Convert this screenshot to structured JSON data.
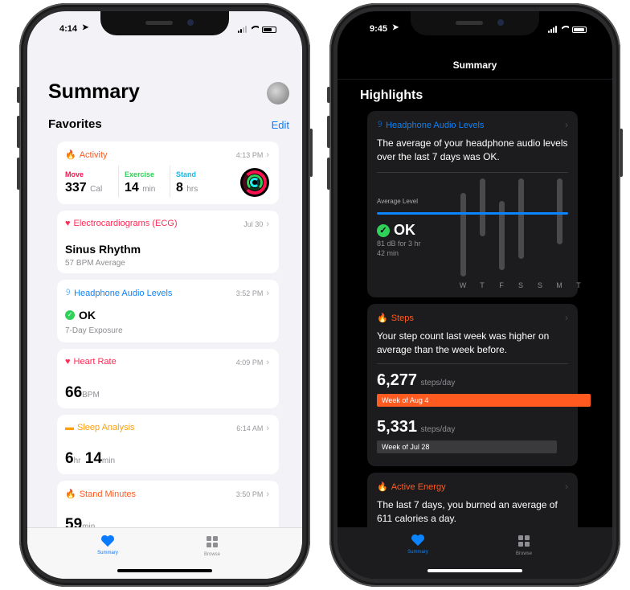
{
  "left": {
    "status_time": "4:14",
    "title": "Summary",
    "favorites": "Favorites",
    "edit": "Edit",
    "activity": {
      "label": "Activity",
      "time": "4:13 PM",
      "move_label": "Move",
      "move_value": "337",
      "move_unit": "Cal",
      "exercise_label": "Exercise",
      "exercise_value": "14",
      "exercise_unit": "min",
      "stand_label": "Stand",
      "stand_value": "8",
      "stand_unit": "hrs"
    },
    "ecg": {
      "label": "Electrocardiograms (ECG)",
      "time": "Jul 30",
      "value": "Sinus Rhythm",
      "sub": "57 BPM Average"
    },
    "audio": {
      "label": "Headphone Audio Levels",
      "time": "3:52 PM",
      "value": "OK",
      "sub": "7-Day Exposure"
    },
    "heart": {
      "label": "Heart Rate",
      "time": "4:09 PM",
      "value": "66",
      "unit": "BPM"
    },
    "sleep": {
      "label": "Sleep Analysis",
      "time": "6:14 AM",
      "h": "6",
      "h_unit": "hr",
      "m": "14",
      "m_unit": "min"
    },
    "stand": {
      "label": "Stand Minutes",
      "time": "3:50 PM",
      "value": "59",
      "unit": "min"
    },
    "tabs": {
      "summary": "Summary",
      "browse": "Browse"
    }
  },
  "right": {
    "status_time": "9:45",
    "header": "Summary",
    "highlights": "Highlights",
    "audio": {
      "label": "Headphone Audio Levels",
      "text": "The average of your headphone audio levels over the last 7 days was OK.",
      "avg_label": "Average Level",
      "value": "OK",
      "sub1": "81 dB for 3 hr",
      "sub2": "42 min",
      "days": [
        "W",
        "T",
        "F",
        "S",
        "S",
        "M",
        "T"
      ]
    },
    "steps": {
      "label": "Steps",
      "text": "Your step count last week was higher on average than the week before.",
      "v1": "6,277",
      "v1_unit": "steps/day",
      "v1_week": "Week of Aug 4",
      "v2": "5,331",
      "v2_unit": "steps/day",
      "v2_week": "Week of Jul 28"
    },
    "energy": {
      "label": "Active Energy",
      "text": "The last 7 days, you burned an average of 611 calories a day."
    },
    "tabs": {
      "summary": "Summary",
      "browse": "Browse"
    }
  },
  "colors": {
    "activity": "#ff5a1f",
    "ecg": "#ff2d55",
    "audio": "#0a84ff",
    "sleep": "#ff9f0a",
    "move": "#fa114f",
    "exercise": "#2fd158",
    "stand": "#1eeaef",
    "ok": "#30d158"
  }
}
